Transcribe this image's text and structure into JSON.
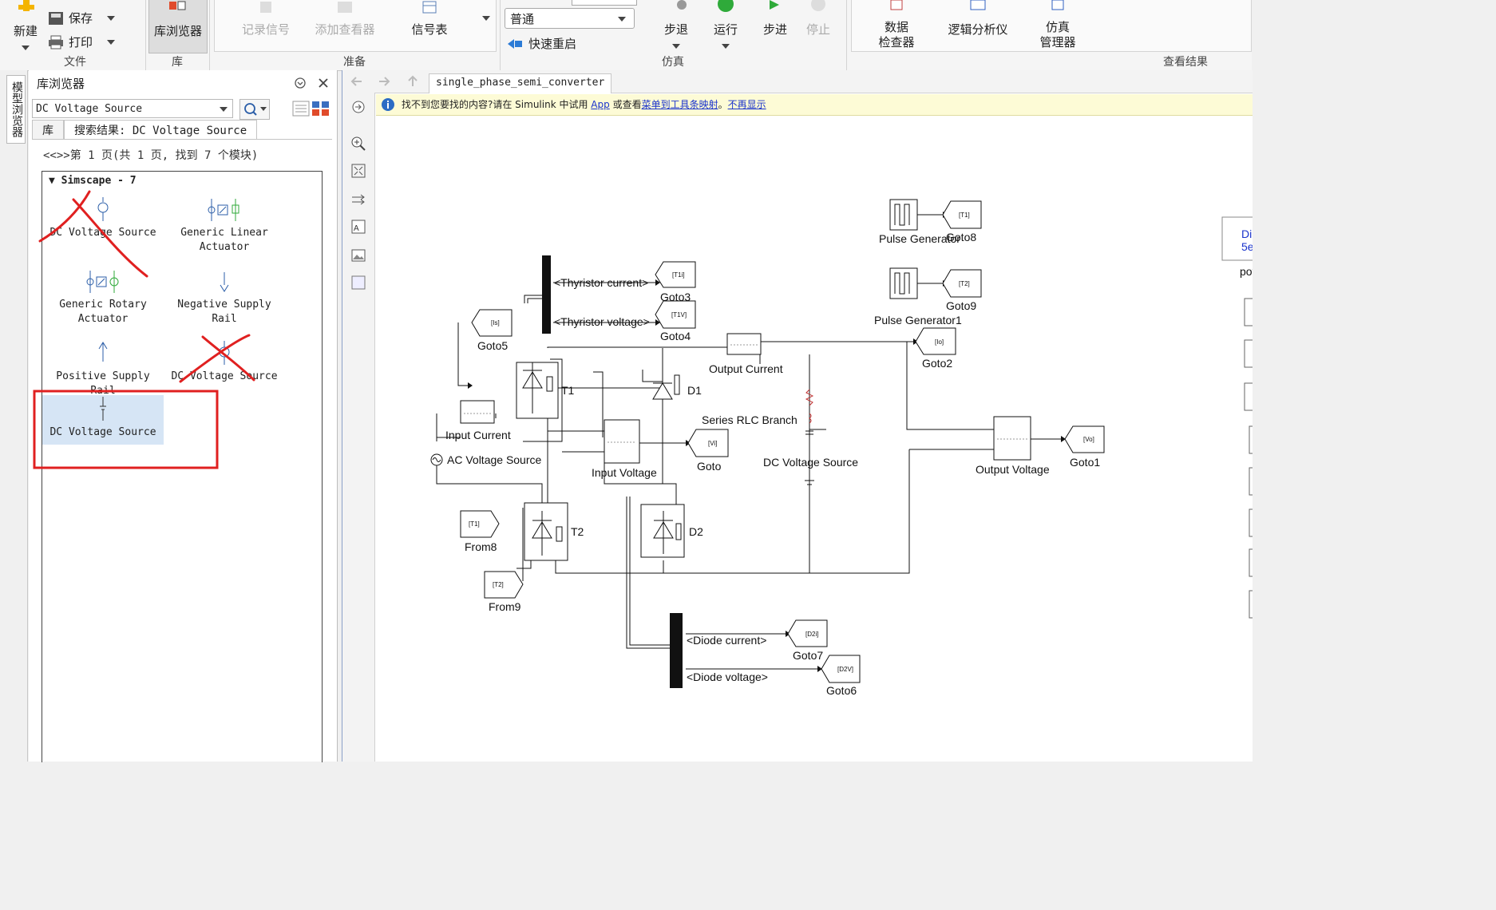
{
  "toolstrip": {
    "file": {
      "section_label": "文件",
      "new_label": "新建",
      "save_label": "保存",
      "print_label": "打印"
    },
    "library": {
      "section_label": "库",
      "library_browser_label": "库浏览器"
    },
    "prepare": {
      "section_label": "准备",
      "log_signals_label": "记录信号",
      "add_viewer_label": "添加查看器",
      "signal_table_label": "信号表"
    },
    "simulate": {
      "section_label": "仿真",
      "mode_value": "普通",
      "fast_restart_label": "快速重启",
      "step_back_label": "步退",
      "run_label": "运行",
      "step_forward_label": "步进",
      "stop_label": "停止"
    },
    "review": {
      "section_label": "查看结果",
      "data_inspector_line1": "数据",
      "data_inspector_line2": "检查器",
      "logic_analyzer_label": "逻辑分析仪",
      "sim_manager_line1": "仿真",
      "sim_manager_line2": "管理器"
    }
  },
  "vertical_tab": {
    "label": "模型浏览器"
  },
  "library_browser": {
    "title": "库浏览器",
    "search_value": "DC Voltage Source",
    "tabs": [
      {
        "label": "库"
      },
      {
        "label": "搜索结果: DC Voltage Source"
      }
    ],
    "pager": "<<>>第 1 页(共 1 页, 找到 7 个模块)",
    "group_title": "Simscape - 7",
    "results": [
      {
        "line1": "DC Voltage Source",
        "line2": ""
      },
      {
        "line1": "Generic Linear",
        "line2": "Actuator"
      },
      {
        "line1": "Generic Rotary",
        "line2": "Actuator"
      },
      {
        "line1": "Negative Supply Rail",
        "line2": ""
      },
      {
        "line1": "Positive Supply Rail",
        "line2": ""
      },
      {
        "line1": "DC Voltage Source",
        "line2": ""
      },
      {
        "line1": "DC Voltage Source",
        "line2": ""
      }
    ]
  },
  "editor": {
    "tab_label": "single_phase_semi_converter",
    "infobar": {
      "text1": "找不到您要找的内容?请在 Simulink 中试用 ",
      "link_app": "App",
      "text2": " 或查看",
      "link_mapping": "菜单到工具条映射",
      "text3": "。",
      "link_dismiss": "不再显示"
    },
    "diagram": {
      "pulse_gen": "Pulse Generator",
      "pulse_gen1": "Pulse Generator1",
      "goto8": "Goto8",
      "goto8_tag": "[T1]",
      "goto9": "Goto9",
      "goto9_tag": "[T2]",
      "goto3": "Goto3",
      "goto3_tag": "[T1i]",
      "goto4": "Goto4",
      "goto4_tag": "[T1V]",
      "goto5": "Goto5",
      "goto5_tag": "[Is]",
      "goto2": "Goto2",
      "goto2_tag": "[Io]",
      "goto": "Goto",
      "goto_tag": "[Vi]",
      "goto1": "Goto1",
      "goto1_tag": "[Vo]",
      "goto7": "Goto7",
      "goto7_tag": "[D2i]",
      "goto6": "Goto6",
      "goto6_tag": "[D2V]",
      "from8": "From8",
      "from8_tag": "[T1]",
      "from9": "From9",
      "from9_tag": "[T2]",
      "thyristor_current": "<Thyristor current>",
      "thyristor_voltage": "<Thyristor voltage>",
      "diode_current": "<Diode current>",
      "diode_voltage": "<Diode voltage>",
      "t1": "T1",
      "t2": "T2",
      "d1": "D1",
      "d2": "D2",
      "output_current": "Output Current",
      "input_current": "Input Current",
      "input_voltage": "Input Voltage",
      "output_voltage": "Output Voltage",
      "ac_source": "AC Voltage Source",
      "rlc": "Series RLC Branch",
      "dc_source": "DC Voltage Source",
      "powergui_fragment": "pov",
      "right_block_line1": "Di",
      "right_block_line2": "5e"
    }
  },
  "colors": {
    "annotation": "#e02020",
    "accent": "#1a33cc",
    "selection": "#d6e5f5"
  }
}
